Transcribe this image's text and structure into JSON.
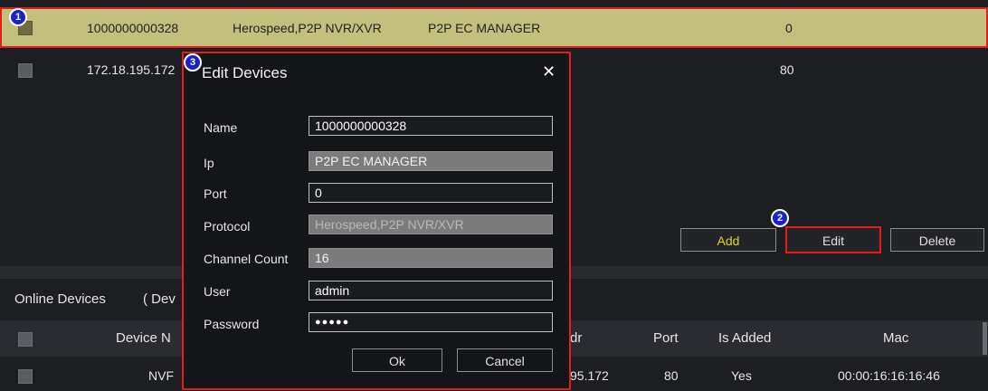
{
  "device_rows": [
    {
      "id": "1000000000328",
      "protocol": "Herospeed,P2P NVR/XVR",
      "ip": "P2P EC MANAGER",
      "port": "0"
    },
    {
      "id": "172.18.195.172",
      "port": "80"
    }
  ],
  "buttons": {
    "add": "Add",
    "edit": "Edit",
    "delete": "Delete"
  },
  "online": {
    "title": "Online Devices",
    "subtitle": "( Dev",
    "headers": {
      "device_name": "Device N",
      "addr": "dr",
      "port": "Port",
      "is_added": "Is Added",
      "mac": "Mac"
    },
    "rows": [
      {
        "device_name": "NVF",
        "addr": "95.172",
        "port": "80",
        "is_added": "Yes",
        "mac": "00:00:16:16:16:46"
      }
    ]
  },
  "dialog": {
    "title": "Edit Devices",
    "close": "✕",
    "labels": {
      "name": "Name",
      "ip": "Ip",
      "port": "Port",
      "protocol": "Protocol",
      "channel_count": "Channel Count",
      "user": "User",
      "password": "Password"
    },
    "values": {
      "name": "1000000000328",
      "ip": "P2P EC MANAGER",
      "port": "0",
      "protocol": "Herospeed,P2P NVR/XVR",
      "channel_count": "16",
      "user": "admin",
      "password": "●●●●●"
    },
    "ok": "Ok",
    "cancel": "Cancel"
  },
  "badges": [
    "1",
    "2",
    "3"
  ],
  "colors": {
    "highlight_row": "#c2c07c",
    "annotation_red": "#e01e1e",
    "add_text": "#e5d700",
    "badge_blue": "#1a23c9"
  }
}
